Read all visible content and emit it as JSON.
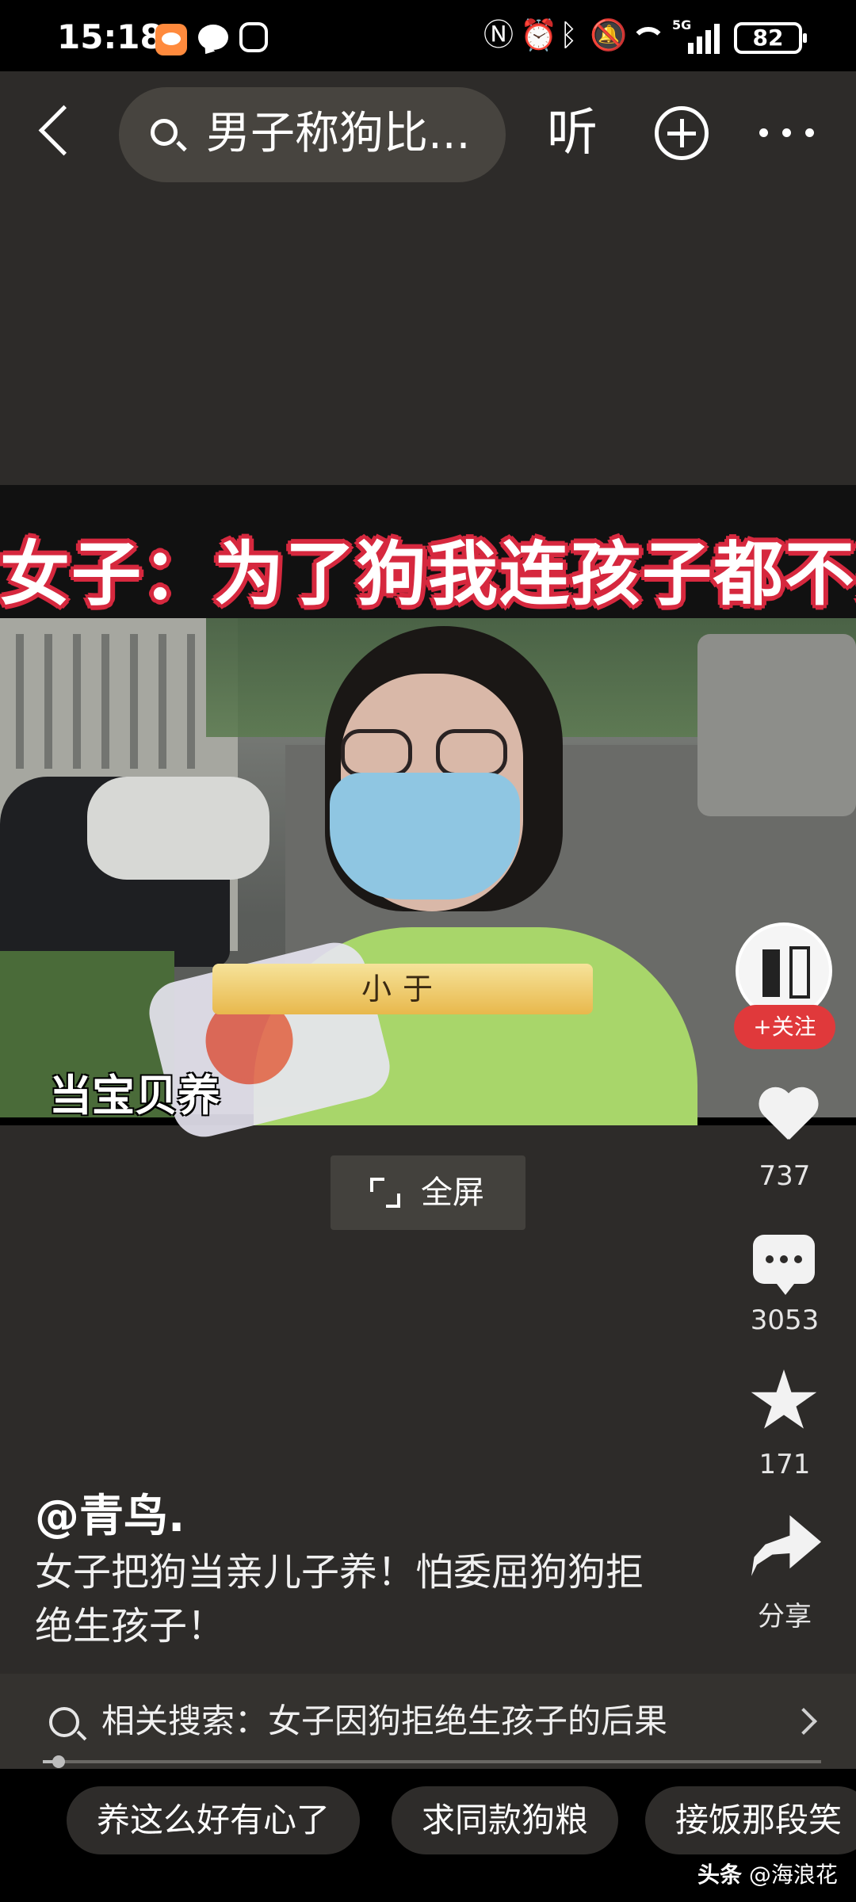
{
  "status_bar": {
    "time": "15:18",
    "network": "5G",
    "battery": "82"
  },
  "header": {
    "search_text": "男子称狗比...",
    "listen_label": "听"
  },
  "video": {
    "headline": "女子：为了狗我连孩子都不要了！",
    "name_tag": "小于",
    "caption": "当宝贝养"
  },
  "fullscreen": {
    "label": "全屏"
  },
  "actions": {
    "follow_label": "+关注",
    "likes": "737",
    "comments": "3053",
    "favorites": "171",
    "share_label": "分享"
  },
  "post": {
    "author": "@青鸟.",
    "description": "女子把狗当亲儿子养！怕委屈狗狗拒绝生孩子！"
  },
  "related": {
    "text": "相关搜索：女子因狗拒绝生孩子的后果"
  },
  "progress": {
    "fraction": 0.02
  },
  "chips": [
    {
      "label": "养这么好有心了"
    },
    {
      "label": "求同款狗粮"
    },
    {
      "label": "接饭那段笑"
    }
  ],
  "watermark": {
    "brand": "头条",
    "handle": "@海浪花"
  },
  "colors": {
    "background": "#2d2b29",
    "follow": "#e0393b",
    "headline_outline": "#d6283e"
  },
  "icons": [
    "back-icon",
    "search-icon",
    "add-icon",
    "more-icon",
    "heart-icon",
    "comment-icon",
    "star-icon",
    "share-icon",
    "expand-icon"
  ]
}
